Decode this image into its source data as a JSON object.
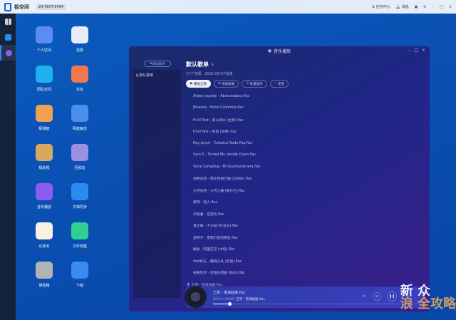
{
  "topbar": {
    "brand": "极空间",
    "device": "Z4-F8XT-6494",
    "task_center": "任务中心",
    "messages": "消息"
  },
  "apps": [
    {
      "label": "个人空间",
      "color": "#5b8cf0"
    },
    {
      "label": "迅雷",
      "color": "#e8ecf8"
    },
    {
      "label": "团队空间",
      "color": "#1fb0f0"
    },
    {
      "label": "论坛",
      "color": "#f0784a"
    },
    {
      "label": "极相册",
      "color": "#f0a050"
    },
    {
      "label": "网盘备份",
      "color": "#4a8ef0"
    },
    {
      "label": "极影视",
      "color": "#d8a860"
    },
    {
      "label": "回收站",
      "color": "#9a90e0"
    },
    {
      "label": "音乐播放",
      "color": "#8a5cf0"
    },
    {
      "label": "文档同步",
      "color": "#2a8af0"
    },
    {
      "label": "记事本",
      "color": "#f8f0e0"
    },
    {
      "label": "文件收集",
      "color": "#30d090"
    },
    {
      "label": "保险箱",
      "color": "#b0b4b8"
    },
    {
      "label": "下载",
      "color": "#3a8af0"
    }
  ],
  "window": {
    "title": "音乐播放"
  },
  "left": {
    "add_playlist": "添加歌单",
    "playlists": [
      "默认歌单"
    ]
  },
  "main": {
    "title": "默认歌单",
    "subtitle": "17个音频　2022-06-07创建",
    "buttons": {
      "play_all": "播放全部",
      "add_song": "添加歌曲",
      "batch": "批量操作",
      "more": "更多"
    },
    "songs": [
      "Alizee Jacotey - Abracadabra.flac",
      "Emeriss - Hotel California.flac",
      "Hi-Vi Test - 高山流水 (古筝).flac",
      "Hi-Vi Test - 知音 (古筝).flac",
      "Ray Lynch - Celestial Soda Pop.flac",
      "Sara K - Turned My Upside Down.flac",
      "Vocal Sampling - Mi Guantanamera.flac",
      "伯爵乐团 - 莫扎特进行曲 (交响乐).flac",
      "大河乐团 - 大河之舞 (爱尔兰).flac",
      "蔡琴 - 恰人.flac",
      "邓丽君 - 恋恋风.flac",
      "鬼太鼓 - 大太鼓 (打击乐).flac",
      "黑鸭子 - 望我们说的那些.flac",
      "群星 - 阿里巴巴 (中阮).flac",
      "木村好夫 - 樱桃小丸 (吉他).flac",
      "帕格尼尼 - 炫技狂想曲 (弦乐).flac",
      "王菲 - 南海姑娘.flac"
    ]
  },
  "player": {
    "title": "王菲 - 南海姑娘.flac",
    "time": "[00:20 / 04:06]",
    "lyric": "王菲 - 南海姑娘.flac",
    "progress": 0.08
  },
  "watermark": {
    "line1": "新 众",
    "line2": "浪 全攻略"
  }
}
